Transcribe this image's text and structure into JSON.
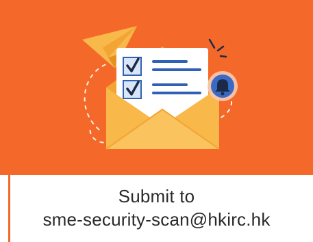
{
  "caption": {
    "line1": "Submit to",
    "line2": "sme-security-scan@hkirc.hk"
  },
  "colors": {
    "hero_background": "#f4692a",
    "envelope": "#f8b84a",
    "envelope_dark": "#f2a534",
    "paper": "#ffffff",
    "accent_blue": "#2f62b5",
    "bell_circle": "#3a6bc4",
    "plane": "#f8b84a",
    "caption_text": "#2a2a2a"
  },
  "icons": {
    "illustration": "envelope-checklist-illustration",
    "plane": "paper-plane-icon",
    "bell": "bell-notification-icon",
    "check": "checkmark-icon"
  }
}
